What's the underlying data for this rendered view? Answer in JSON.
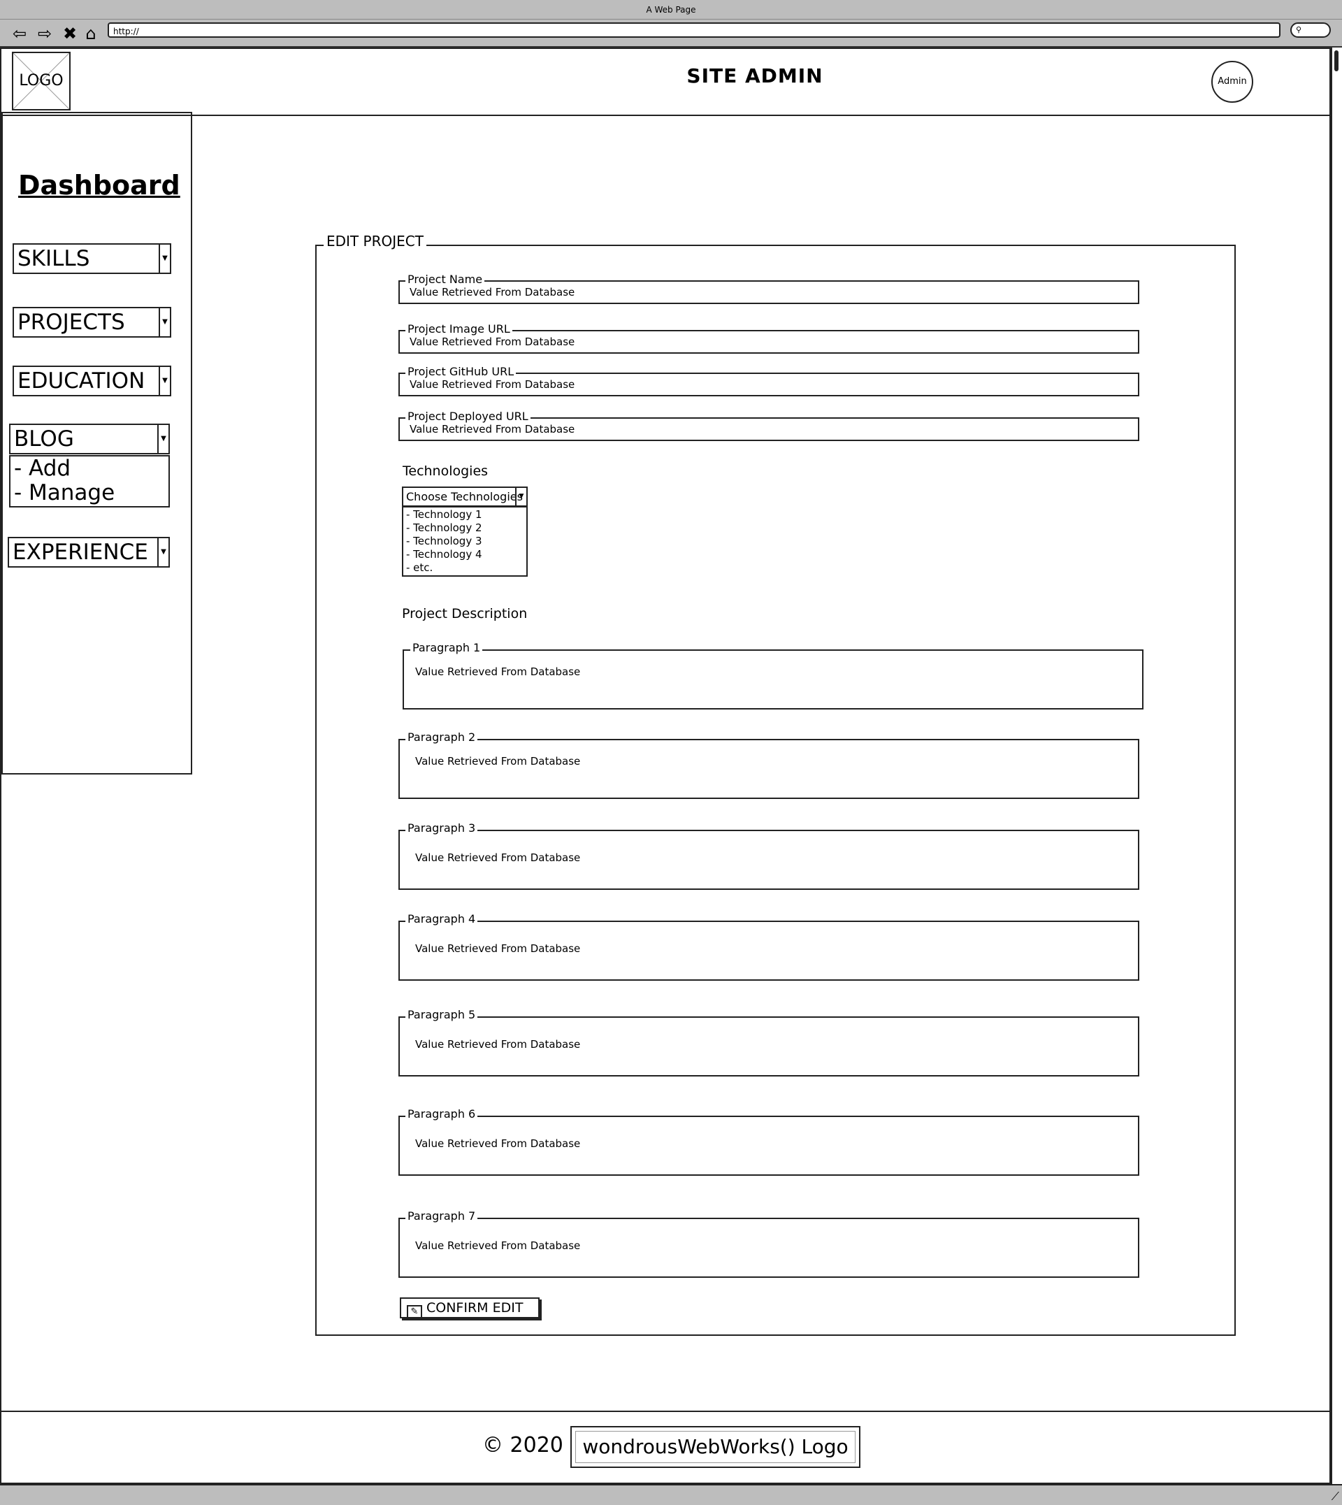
{
  "browser": {
    "window_title": "A Web Page",
    "url": "http://"
  },
  "header": {
    "logo_text": "LOGO",
    "title": "SITE ADMIN",
    "avatar_label": "Admin"
  },
  "sidebar": {
    "title": "Dashboard",
    "items": [
      {
        "label": "SKILLS"
      },
      {
        "label": "PROJECTS"
      },
      {
        "label": "EDUCATION"
      },
      {
        "label": "BLOG",
        "submenu": [
          "- Add",
          "- Manage"
        ]
      },
      {
        "label": "EXPERIENCE"
      }
    ]
  },
  "form": {
    "legend": "EDIT PROJECT",
    "fields": [
      {
        "label": "Project Name",
        "value": "Value Retrieved From Database"
      },
      {
        "label": "Project Image URL",
        "value": "Value Retrieved From Database"
      },
      {
        "label": "Project GitHub URL",
        "value": "Value Retrieved From Database"
      },
      {
        "label": "Project Deployed URL",
        "value": "Value Retrieved From Database"
      }
    ],
    "technologies": {
      "label": "Technologies",
      "dropdown": "Choose Technologies",
      "options": [
        "- Technology 1",
        "- Technology 2",
        "- Technology 3",
        "- Technology 4",
        "- etc."
      ]
    },
    "description_label": "Project Description",
    "paragraphs": [
      {
        "label": "Paragraph 1",
        "value": "Value Retrieved From Database"
      },
      {
        "label": "Paragraph 2",
        "value": "Value Retrieved From Database"
      },
      {
        "label": "Paragraph 3",
        "value": "Value Retrieved From Database"
      },
      {
        "label": "Paragraph 4",
        "value": "Value Retrieved From Database"
      },
      {
        "label": "Paragraph 5",
        "value": "Value Retrieved From Database"
      },
      {
        "label": "Paragraph 6",
        "value": "Value Retrieved From Database"
      },
      {
        "label": "Paragraph 7",
        "value": "Value Retrieved From Database"
      }
    ],
    "confirm_label": "CONFIRM EDIT"
  },
  "footer": {
    "copyright": "© 2020",
    "logo_text": "wondrousWebWorks() Logo"
  }
}
